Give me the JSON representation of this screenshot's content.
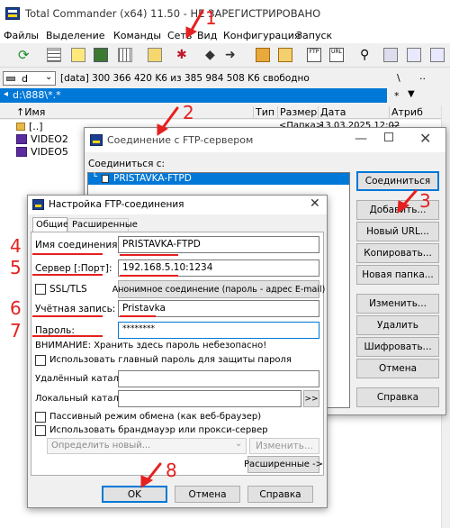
{
  "tc": {
    "title": "Total Commander (x64) 11.50 - НЕ ЗАРЕГИСТРИРОВАНО",
    "menu": [
      "Файлы",
      "Выделение",
      "Команды",
      "Сеть",
      "Вид",
      "Конфигурация",
      "Запуск"
    ],
    "drive": "d",
    "drive_info": "[data]  300 366 420 K6 из 385 984 508 K6 свободно",
    "drive_root": "\\",
    "drive_up": "..",
    "path": "d:\\888\\*.*",
    "path_star": "*",
    "path_arrow": "▼",
    "columns": {
      "name": "↑Имя",
      "type": "Тип",
      "size": "Размер",
      "date": "Дата",
      "attr": "Атриб"
    },
    "files": [
      {
        "name": "[..]",
        "size": "<Папка>",
        "date": "13.03.2025 12:02",
        "attr": "—"
      },
      {
        "name": "VIDEO2"
      },
      {
        "name": "VIDEO5"
      }
    ]
  },
  "ftp_dialog": {
    "title": "Соединение с FTP-сервером",
    "connect_to_label": "Соединиться с:",
    "list_item": "PRISTAVKA-FTPD",
    "buttons": [
      "Соединиться",
      "Добавить...",
      "Новый URL...",
      "Копировать...",
      "Новая папка...",
      "Изменить...",
      "Удалить",
      "Шифровать...",
      "Отмена",
      "Справка"
    ]
  },
  "settings_dialog": {
    "title": "Настройка FTP-соединения",
    "tabs": [
      "Общие",
      "Расширенные"
    ],
    "name_label": "Имя соединения:",
    "name_value": "PRISTAVKA-FTPD",
    "server_label": "Сервер [:Порт]:",
    "server_value": "192.168.5.10:1234",
    "ssl_label": "SSL/TLS",
    "anon_button": "Анонимное соединение (пароль - адрес E-mail)",
    "account_label": "Учётная запись:",
    "account_value": "Pristavka",
    "password_label": "Пароль:",
    "password_value": "********",
    "warning": "ВНИМАНИЕ: Хранить здесь пароль небезопасно!",
    "master_pw_label": "Использовать главный пароль для защиты пароля",
    "remote_dir_label": "Удалённый каталог:",
    "local_dir_label": "Локальный каталог:",
    "browse_label": ">>",
    "passive_label": "Пассивный режим обмена (как веб-браузер)",
    "firewall_label": "Использовать брандмауэр или прокси-сервер",
    "proxy_define": "Определить новый...",
    "proxy_change": "Изменить...",
    "advanced_button": "Расширенные ->",
    "ok_button": "OK",
    "cancel_button": "Отмена",
    "help_button": "Справка"
  },
  "annotations": [
    "1",
    "2",
    "3",
    "4",
    "5",
    "6",
    "7",
    "8"
  ],
  "colors": {
    "accent": "#0078d7",
    "annotation_red": "#e52020",
    "selection": "#0078d7"
  }
}
